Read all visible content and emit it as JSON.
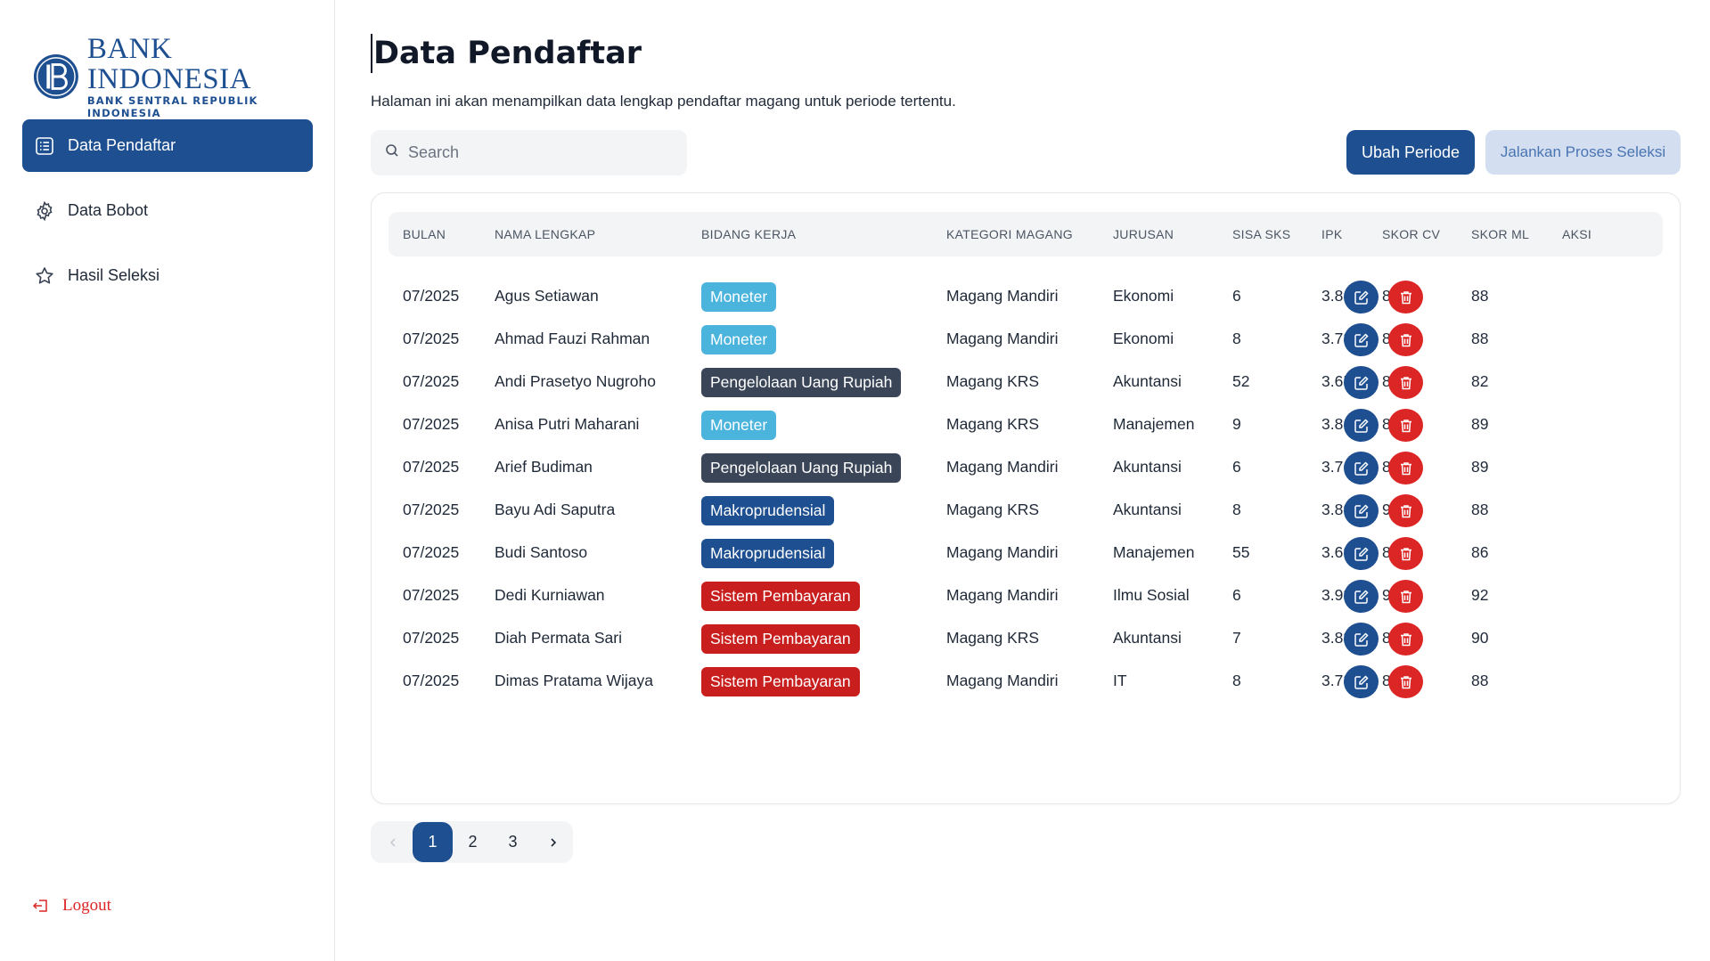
{
  "brand": {
    "title": "BANK INDONESIA",
    "subtitle": "BANK SENTRAL REPUBLIK INDONESIA",
    "color": "#1e4f91"
  },
  "sidebar": {
    "items": [
      {
        "label": "Data Pendaftar",
        "icon": "list-icon",
        "active": true
      },
      {
        "label": "Data Bobot",
        "icon": "gear-icon",
        "active": false
      },
      {
        "label": "Hasil Seleksi",
        "icon": "star-icon",
        "active": false
      }
    ],
    "logout_label": "Logout"
  },
  "header": {
    "title": "Data Pendaftar",
    "description": "Halaman ini akan menampilkan data lengkap pendaftar magang untuk periode tertentu."
  },
  "search": {
    "placeholder": "Search",
    "value": ""
  },
  "actions": {
    "primary_label": "Ubah Periode",
    "secondary_label": "Jalankan Proses Seleksi"
  },
  "table": {
    "headers": [
      "BULAN",
      "NAMA LENGKAP",
      "BIDANG KERJA",
      "KATEGORI MAGANG",
      "JURUSAN",
      "SISA SKS",
      "IPK",
      "SKOR CV",
      "SKOR ML",
      "AKSI"
    ],
    "rows": [
      {
        "bulan": "07/2025",
        "nama": "Agus Setiawan",
        "bidang": "Moneter",
        "bidang_type": "moneter",
        "kategori": "Magang Mandiri",
        "jurusan": "Ekonomi",
        "sks": "6",
        "ipk": "3.81",
        "cv": "86",
        "ml": "88"
      },
      {
        "bulan": "07/2025",
        "nama": "Ahmad Fauzi Rahman",
        "bidang": "Moneter",
        "bidang_type": "moneter",
        "kategori": "Magang Mandiri",
        "jurusan": "Ekonomi",
        "sks": "8",
        "ipk": "3.78",
        "cv": "86",
        "ml": "88"
      },
      {
        "bulan": "07/2025",
        "nama": "Andi Prasetyo Nugroho",
        "bidang": "Pengelolaan Uang Rupiah",
        "bidang_type": "pengelolaan",
        "kategori": "Magang KRS",
        "jurusan": "Akuntansi",
        "sks": "52",
        "ipk": "3.65",
        "cv": "85",
        "ml": "82"
      },
      {
        "bulan": "07/2025",
        "nama": "Anisa Putri Maharani",
        "bidang": "Moneter",
        "bidang_type": "moneter",
        "kategori": "Magang KRS",
        "jurusan": "Manajemen",
        "sks": "9",
        "ipk": "3.8",
        "cv": "87",
        "ml": "89"
      },
      {
        "bulan": "07/2025",
        "nama": "Arief Budiman",
        "bidang": "Pengelolaan Uang Rupiah",
        "bidang_type": "pengelolaan",
        "kategori": "Magang Mandiri",
        "jurusan": "Akuntansi",
        "sks": "6",
        "ipk": "3.76",
        "cv": "87",
        "ml": "89"
      },
      {
        "bulan": "07/2025",
        "nama": "Bayu Adi Saputra",
        "bidang": "Makroprudensial",
        "bidang_type": "makro",
        "kategori": "Magang KRS",
        "jurusan": "Akuntansi",
        "sks": "8",
        "ipk": "3.89",
        "cv": "91",
        "ml": "88"
      },
      {
        "bulan": "07/2025",
        "nama": "Budi Santoso",
        "bidang": "Makroprudensial",
        "bidang_type": "makro",
        "kategori": "Magang Mandiri",
        "jurusan": "Manajemen",
        "sks": "55",
        "ipk": "3.69",
        "cv": "83",
        "ml": "86"
      },
      {
        "bulan": "07/2025",
        "nama": "Dedi Kurniawan",
        "bidang": "Sistem Pembayaran",
        "bidang_type": "sistem",
        "kategori": "Magang Mandiri",
        "jurusan": "Ilmu Sosial",
        "sks": "6",
        "ipk": "3.93",
        "cv": "94",
        "ml": "92"
      },
      {
        "bulan": "07/2025",
        "nama": "Diah Permata Sari",
        "bidang": "Sistem Pembayaran",
        "bidang_type": "sistem",
        "kategori": "Magang KRS",
        "jurusan": "Akuntansi",
        "sks": "7",
        "ipk": "3.83",
        "cv": "88",
        "ml": "90"
      },
      {
        "bulan": "07/2025",
        "nama": "Dimas Pratama Wijaya",
        "bidang": "Sistem Pembayaran",
        "bidang_type": "sistem",
        "kategori": "Magang Mandiri",
        "jurusan": "IT",
        "sks": "8",
        "ipk": "3.78",
        "cv": "87",
        "ml": "88"
      }
    ]
  },
  "pagination": {
    "pages": [
      "1",
      "2",
      "3"
    ],
    "current": "1",
    "prev_icon": "chevron-left-icon",
    "next_icon": "chevron-right-icon"
  }
}
